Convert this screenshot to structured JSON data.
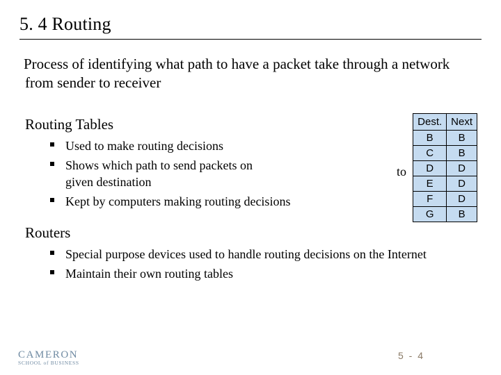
{
  "title": "5. 4  Routing",
  "intro": "Process of identifying what path to have a packet take through a network from sender to receiver",
  "section1": {
    "heading": "Routing Tables",
    "bullets": [
      "Used to make routing decisions",
      "Shows which path to send packets on",
      "given destination",
      "Kept by computers making routing decisions"
    ]
  },
  "stray_to": "to",
  "section2": {
    "heading": "Routers",
    "bullets": [
      "Special purpose devices used to handle routing decisions on the Internet",
      "Maintain their own routing tables"
    ]
  },
  "table": {
    "headers": {
      "dest": "Dest.",
      "next": "Next"
    },
    "rows": [
      {
        "dest": "B",
        "next": "B"
      },
      {
        "dest": "C",
        "next": "B"
      },
      {
        "dest": "D",
        "next": "D"
      },
      {
        "dest": "E",
        "next": "D"
      },
      {
        "dest": "F",
        "next": "D"
      },
      {
        "dest": "G",
        "next": "B"
      }
    ]
  },
  "logo": {
    "line1": "CAMERON",
    "line2": "SCHOOL of BUSINESS"
  },
  "page": "5 - 4",
  "chart_data": {
    "type": "table",
    "title": "Routing Table",
    "columns": [
      "Dest.",
      "Next"
    ],
    "rows": [
      [
        "B",
        "B"
      ],
      [
        "C",
        "B"
      ],
      [
        "D",
        "D"
      ],
      [
        "E",
        "D"
      ],
      [
        "F",
        "D"
      ],
      [
        "G",
        "B"
      ]
    ]
  }
}
